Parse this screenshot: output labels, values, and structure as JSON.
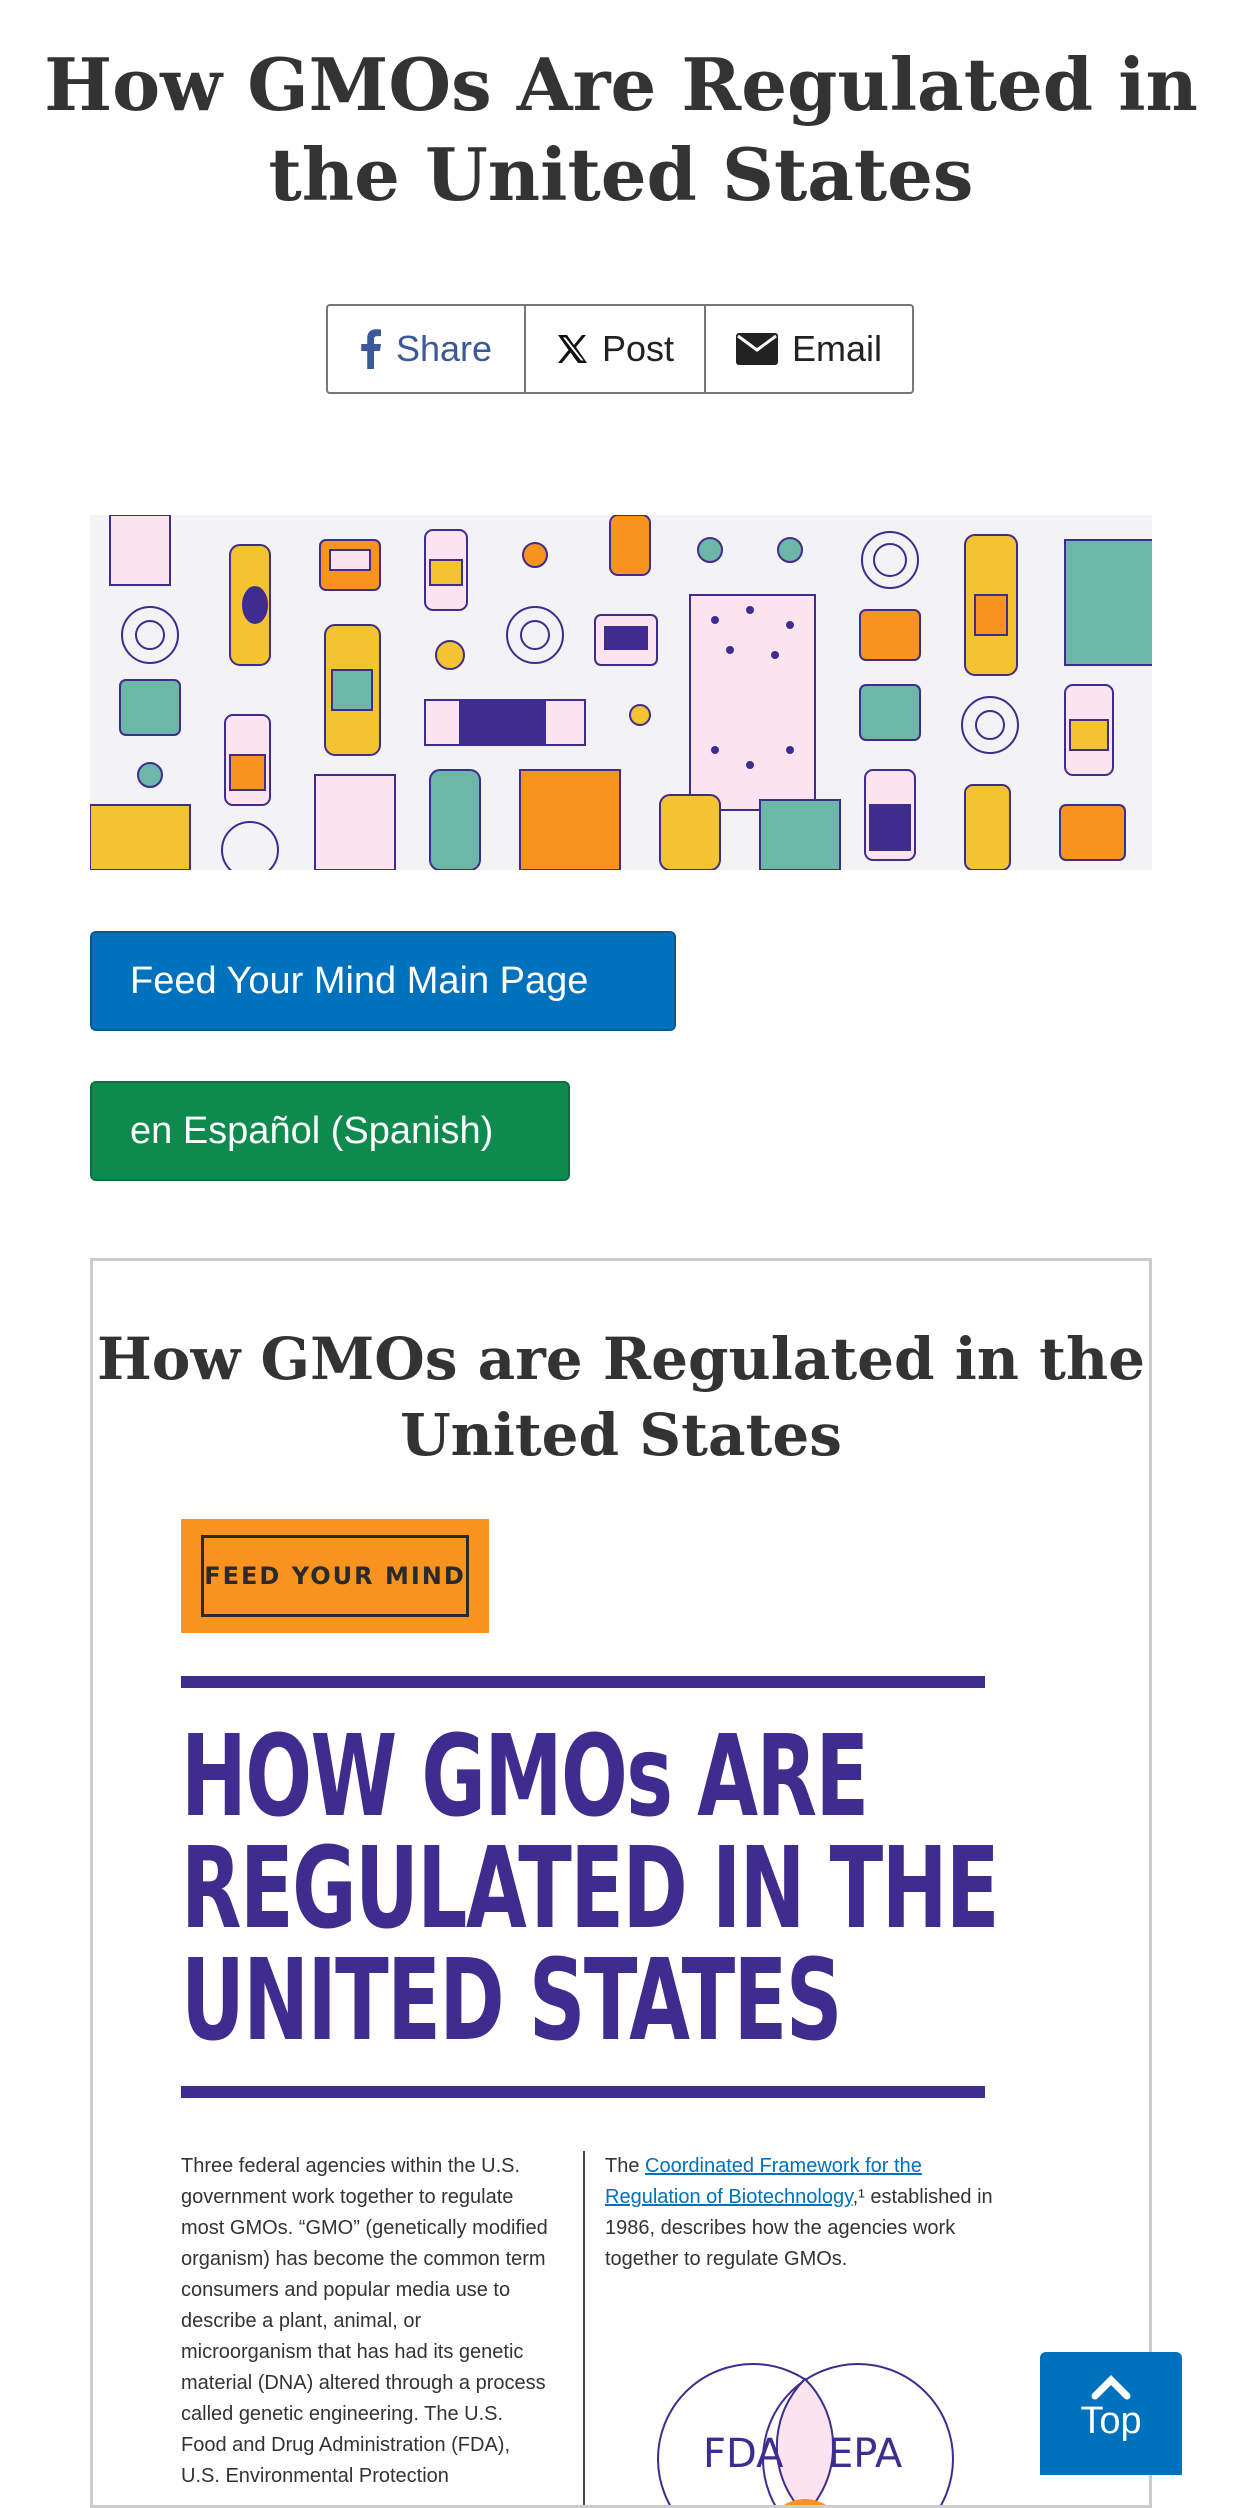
{
  "page": {
    "title": "How GMOs Are Regulated in the United States"
  },
  "share": {
    "facebook_label": "Share",
    "x_label": "Post",
    "email_label": "Email"
  },
  "buttons": {
    "main_page": "Feed Your Mind Main Page",
    "spanish": "en Español (Spanish)"
  },
  "document": {
    "heading": "How GMOs are Regulated in the United States",
    "badge": "FEED YOUR MIND",
    "title_line1": "HOW GMOs ARE",
    "title_line2": "REGULATED IN THE",
    "title_line3": "UNITED STATES",
    "left_col": "Three federal agencies within the U.S. government work together to regulate most GMOs. “GMO” (genetically modified organism) has become the common term consumers and popular media use to describe a plant, animal, or microorganism that has had its genetic material (DNA) altered through a process called genetic engineering. The U.S. Food and Drug Administration (FDA), U.S. Environmental Protection",
    "right_prefix": "The ",
    "right_link": "Coordinated Framework for the Regulation of Biotechnology",
    "right_suffix": ",¹ established in 1986, describes how the agencies work together to regulate GMOs.",
    "venn_left": "FDA",
    "venn_right": "EPA"
  },
  "back_to_top": {
    "label": "Top"
  },
  "colors": {
    "primary_blue": "#0071bc",
    "green": "#0e8a4e",
    "purple": "#3e2c8f",
    "orange": "#f7931e",
    "yellow": "#f4c430",
    "teal": "#6db7a8"
  }
}
